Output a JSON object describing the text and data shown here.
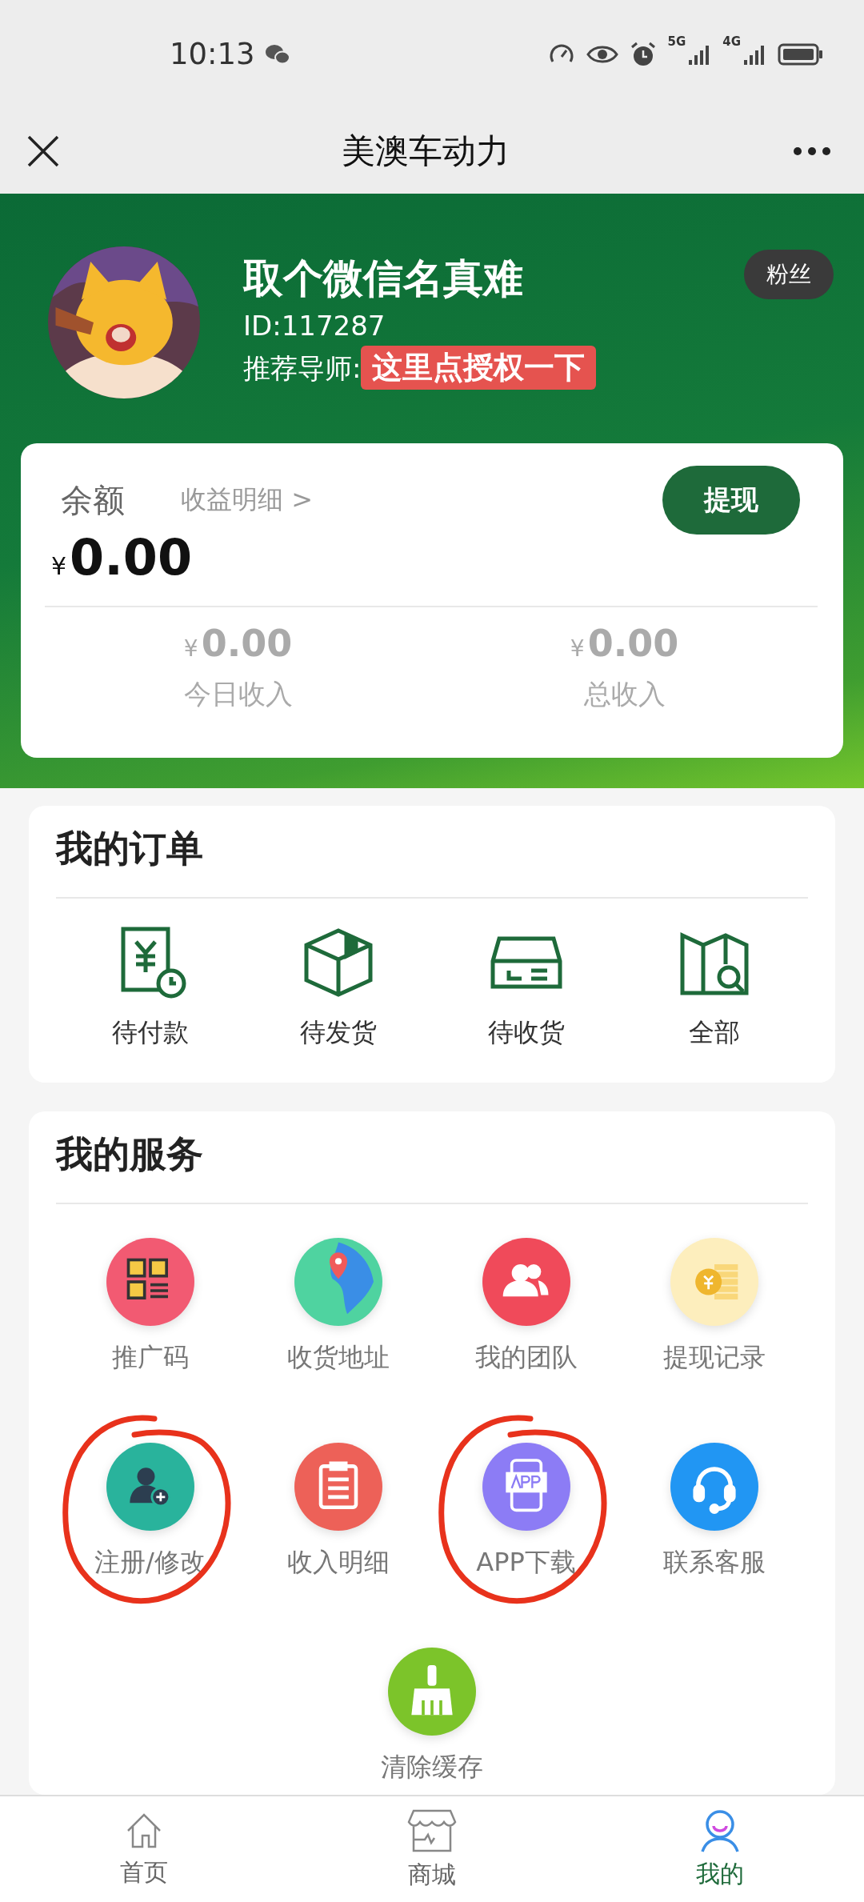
{
  "status_bar": {
    "time": "10:13",
    "network_1": "5G",
    "network_2": "4G"
  },
  "nav": {
    "title": "美澳车动力"
  },
  "profile": {
    "name": "取个微信名真难",
    "id": "ID:117287",
    "mentor_label": "推荐导师:",
    "mentor_value": "这里点授权一下",
    "fans_button": "粉丝"
  },
  "balance": {
    "label": "余额",
    "detail_link": "收益明细 >",
    "currency": "¥",
    "amount": "0.00",
    "withdraw_button": "提现",
    "stats": [
      {
        "currency": "¥",
        "value": "0.00",
        "label": "今日收入"
      },
      {
        "currency": "¥",
        "value": "0.00",
        "label": "总收入"
      }
    ]
  },
  "orders": {
    "title": "我的订单",
    "items": [
      {
        "label": "待付款"
      },
      {
        "label": "待发货"
      },
      {
        "label": "待收货"
      },
      {
        "label": "全部"
      }
    ]
  },
  "services": {
    "title": "我的服务",
    "items": [
      {
        "label": "推广码",
        "annotated": false
      },
      {
        "label": "收货地址",
        "annotated": false
      },
      {
        "label": "我的团队",
        "annotated": false
      },
      {
        "label": "提现记录",
        "annotated": false
      },
      {
        "label": "注册/修改",
        "annotated": true
      },
      {
        "label": "收入明细",
        "annotated": false
      },
      {
        "label": "APP下载",
        "annotated": true
      },
      {
        "label": "联系客服",
        "annotated": false
      },
      {
        "label": "清除缓存",
        "annotated": false
      }
    ]
  },
  "tab_bar": [
    {
      "label": "首页",
      "selected": false
    },
    {
      "label": "商城",
      "selected": false
    },
    {
      "label": "我的",
      "selected": true
    }
  ]
}
